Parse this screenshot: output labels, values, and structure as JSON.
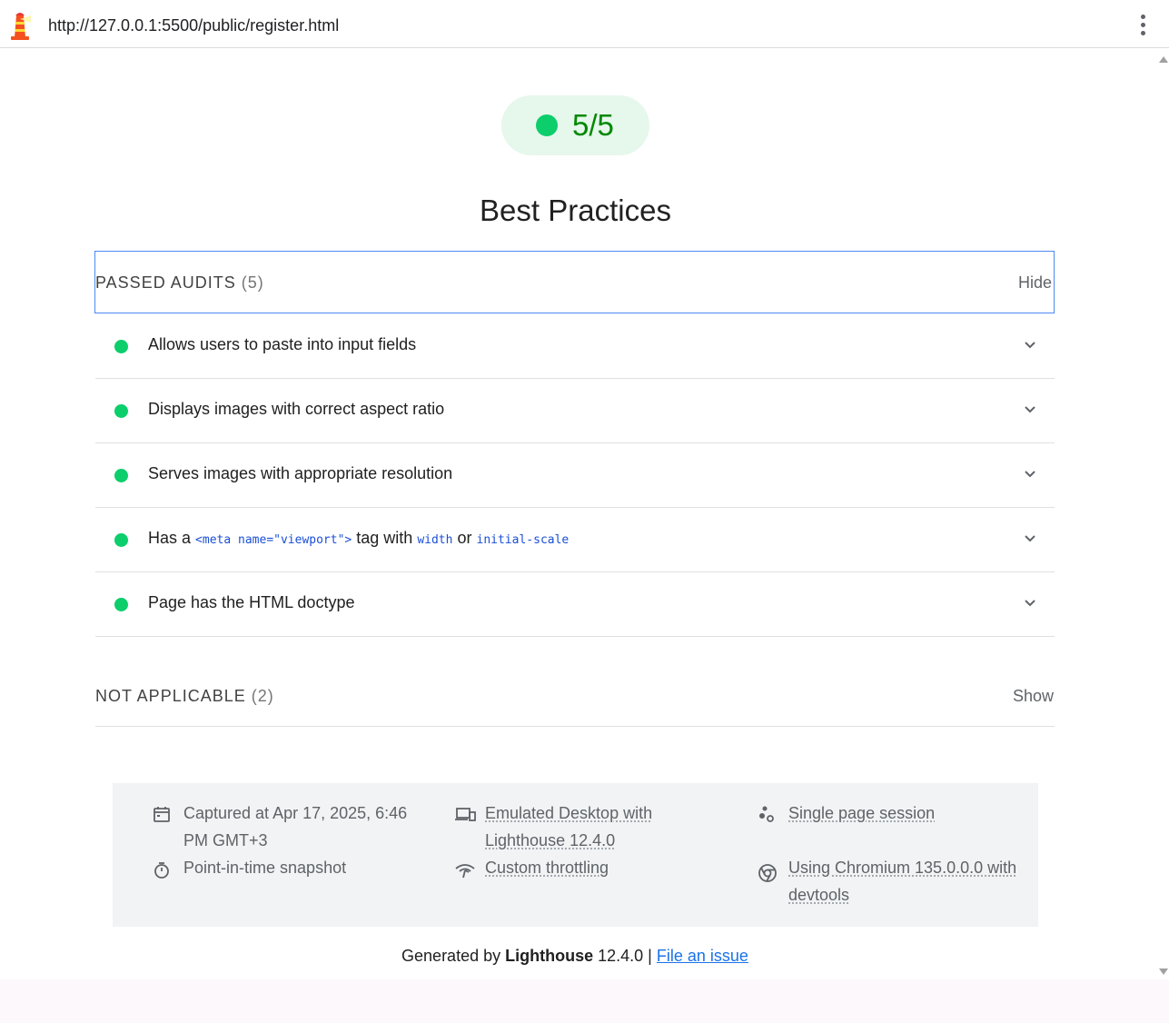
{
  "browser": {
    "url": "http://127.0.0.1:5500/public/register.html",
    "logo_icon": "lighthouse-icon",
    "menu_icon": "kebab-menu-icon"
  },
  "score": {
    "value": "5/5",
    "color": "#0cce6b",
    "text_color": "#008800"
  },
  "category": {
    "title": "Best Practices"
  },
  "passed_group": {
    "title": "PASSED AUDITS",
    "count": "(5)",
    "toggle": "Hide",
    "audits": [
      {
        "label": "Allows users to paste into input fields"
      },
      {
        "label": "Displays images with correct aspect ratio"
      },
      {
        "label": "Serves images with appropriate resolution"
      },
      {
        "label_prefix": "Has a",
        "code1": "<meta name=\"viewport\">",
        "mid": "tag with",
        "code2": "width",
        "or": "or",
        "code3": "initial-scale"
      },
      {
        "label": "Page has the HTML doctype"
      }
    ]
  },
  "na_group": {
    "title": "NOT APPLICABLE",
    "count": "(2)",
    "toggle": "Show"
  },
  "runtime": {
    "captured_line1": "Captured at Apr 17, 2025, 6:46",
    "captured_line2": "PM GMT+3",
    "snapshot": "Point-in-time snapshot",
    "device_line1": "Emulated Desktop with",
    "device_line2": "Lighthouse 12.4.0",
    "throttling": "Custom throttling",
    "session": "Single page session",
    "chromium_line1": "Using Chromium 135.0.0.0 with",
    "chromium_line2": "devtools",
    "icons": [
      "calendar-icon",
      "stopwatch-icon",
      "devices-icon",
      "network-icon",
      "session-icon",
      "chrome-icon"
    ]
  },
  "footer": {
    "generated_by": "Generated by",
    "brand": "Lighthouse",
    "version": "12.4.0 |",
    "issue_link": "File an issue"
  }
}
